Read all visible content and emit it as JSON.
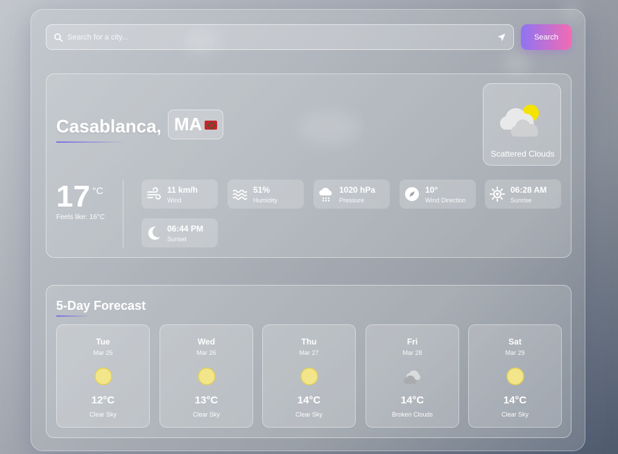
{
  "search": {
    "placeholder": "Search for a city...",
    "button_label": "Search"
  },
  "current": {
    "city": "Casablanca,",
    "country": "MA",
    "condition": "Scattered Clouds",
    "temperature": "17",
    "unit": "°C",
    "feels_like": "Feels like: 16°C",
    "stats": [
      {
        "icon": "wind-icon",
        "value": "11 km/h",
        "label": "Wind"
      },
      {
        "icon": "humidity-icon",
        "value": "51%",
        "label": "Humidity"
      },
      {
        "icon": "pressure-icon",
        "value": "1020 hPa",
        "label": "Pressure"
      },
      {
        "icon": "compass-icon",
        "value": "10°",
        "label": "Wind Direction"
      },
      {
        "icon": "sunrise-icon",
        "value": "06:28 AM",
        "label": "Sunrise"
      },
      {
        "icon": "sunset-icon",
        "value": "06:44 PM",
        "label": "Sunset"
      }
    ]
  },
  "forecast": {
    "title": "5-Day Forecast",
    "days": [
      {
        "day": "Tue",
        "date": "Mar 25",
        "icon": "sun-icon",
        "temp": "12°C",
        "desc": "Clear Sky"
      },
      {
        "day": "Wed",
        "date": "Mar 26",
        "icon": "sun-icon",
        "temp": "13°C",
        "desc": "Clear Sky"
      },
      {
        "day": "Thu",
        "date": "Mar 27",
        "icon": "sun-icon",
        "temp": "14°C",
        "desc": "Clear Sky"
      },
      {
        "day": "Fri",
        "date": "Mar 28",
        "icon": "cloud-icon",
        "temp": "14°C",
        "desc": "Broken Clouds"
      },
      {
        "day": "Sat",
        "date": "Mar 29",
        "icon": "sun-icon",
        "temp": "14°C",
        "desc": "Clear Sky"
      }
    ]
  },
  "colors": {
    "accent_start": "#8e74f2",
    "accent_end": "#f26bb4",
    "sun": "#f3e58a"
  }
}
